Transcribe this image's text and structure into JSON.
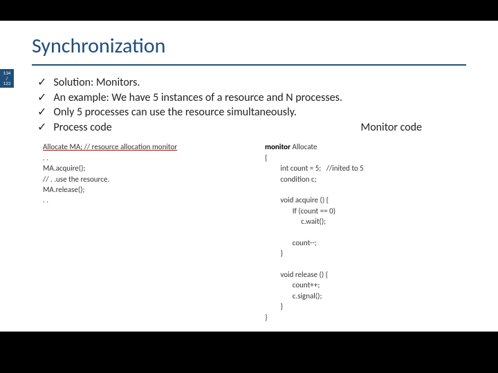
{
  "slide": {
    "title": "Synchronization",
    "page_badge": "134 / 123",
    "bullets": [
      "Solution: Monitors.",
      "An example: We have 5 instances of a resource and N processes.",
      "Only 5 processes can use the resource simultaneously."
    ],
    "last_bullet_left": "Process code",
    "last_bullet_right": "Monitor code",
    "process_code_l1": "Allocate MA; // resource allocation monitor",
    "process_code_rest": ". .\nMA.acquire();\n// . .use the resource.\nMA.release();\n. .",
    "monitor_code_kw": "monitor",
    "monitor_code_body": " Allocate\n{\n         int count = 5;   //inited to 5\n         condition c;\n\n         void acquire () {\n                If (count == 0)\n                     c.wait();\n\n                count--;\n         }\n\n         void release () {\n                count++;\n                c.signal();\n         }\n}"
  }
}
